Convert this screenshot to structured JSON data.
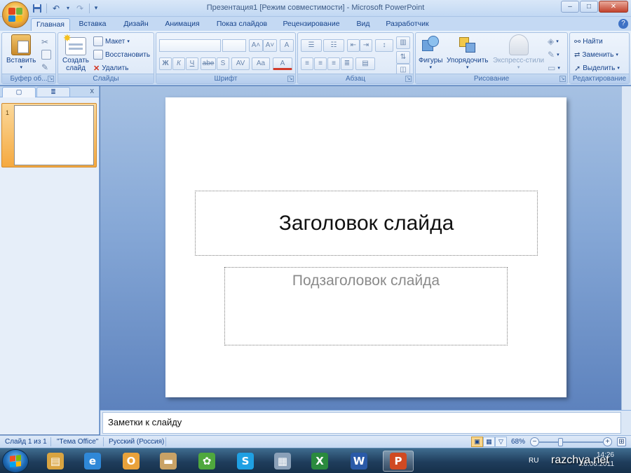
{
  "window": {
    "title": "Презентация1 [Режим совместимости] - Microsoft PowerPoint",
    "controls": [
      "–",
      "□",
      "✕"
    ]
  },
  "quick_access": {
    "items": [
      "save-icon",
      "undo-icon",
      "redo-icon",
      "customize-icon"
    ]
  },
  "tabs": [
    {
      "label": "Главная",
      "active": true
    },
    {
      "label": "Вставка"
    },
    {
      "label": "Дизайн"
    },
    {
      "label": "Анимация"
    },
    {
      "label": "Показ слайдов"
    },
    {
      "label": "Рецензирование"
    },
    {
      "label": "Вид"
    },
    {
      "label": "Разработчик"
    }
  ],
  "ribbon": {
    "clipboard": {
      "paste": "Вставить",
      "label": "Буфер об...",
      "launcher": "↘"
    },
    "slides": {
      "new_slide_1": "Создать",
      "new_slide_2": "слайд",
      "layout": "Макет",
      "reset": "Восстановить",
      "delete": "Удалить",
      "label": "Слайды"
    },
    "font": {
      "grow": "A˄",
      "shrink": "A˅",
      "clear": "A",
      "bold": "Ж",
      "italic": "К",
      "underline": "Ч",
      "strike": "abe",
      "shadow": "S",
      "spacing": "AV",
      "case": "Aa",
      "color": "A",
      "label": "Шрифт",
      "launcher": "↘"
    },
    "paragraph": {
      "label": "Абзац",
      "launcher": "↘"
    },
    "drawing": {
      "shapes": "Фигуры",
      "arrange": "Упорядочить",
      "quick_styles": "Экспресс-стили",
      "label": "Рисование",
      "launcher": "↘"
    },
    "editing": {
      "find": "Найти",
      "replace": "Заменить",
      "select": "Выделить",
      "label": "Редактирование"
    }
  },
  "left_pane": {
    "tab_slides": "▢",
    "tab_outline": "≣",
    "close": "x",
    "slide_number": "1"
  },
  "slide": {
    "title_placeholder": "Заголовок слайда",
    "subtitle_placeholder": "Подзаголовок слайда"
  },
  "notes": {
    "placeholder": "Заметки к слайду"
  },
  "status": {
    "slide_info": "Слайд 1 из 1",
    "theme": "\"Тема Office\"",
    "language": "Русский (Россия)",
    "zoom": "68%",
    "zoom_minus": "−",
    "zoom_plus": "+"
  },
  "taskbar": {
    "apps": [
      {
        "name": "explorer",
        "glyph": "▤",
        "color": "#d9a441"
      },
      {
        "name": "internet-explorer",
        "glyph": "e",
        "color": "#2f88d8"
      },
      {
        "name": "outlook",
        "glyph": "O",
        "color": "#e9a23b"
      },
      {
        "name": "folder",
        "glyph": "▬",
        "color": "#c9a266"
      },
      {
        "name": "icq",
        "glyph": "✿",
        "color": "#4fa83d"
      },
      {
        "name": "skype",
        "glyph": "S",
        "color": "#1fa0e3"
      },
      {
        "name": "calculator",
        "glyph": "▦",
        "color": "#8aa0b8"
      },
      {
        "name": "excel",
        "glyph": "X",
        "color": "#2a8a3e"
      },
      {
        "name": "word",
        "glyph": "W",
        "color": "#2a5aa8"
      },
      {
        "name": "powerpoint",
        "glyph": "P",
        "color": "#d04a22",
        "active": true
      }
    ],
    "lang": "RU",
    "time": "14:26",
    "date": "26.06.2011"
  },
  "watermark": "razchya.net",
  "colors": {
    "accent": "#15428b",
    "workspace_top": "#a6c1e3",
    "workspace_bottom": "#5d82bd",
    "slide_thumb_highlight": "#f5a93f"
  }
}
